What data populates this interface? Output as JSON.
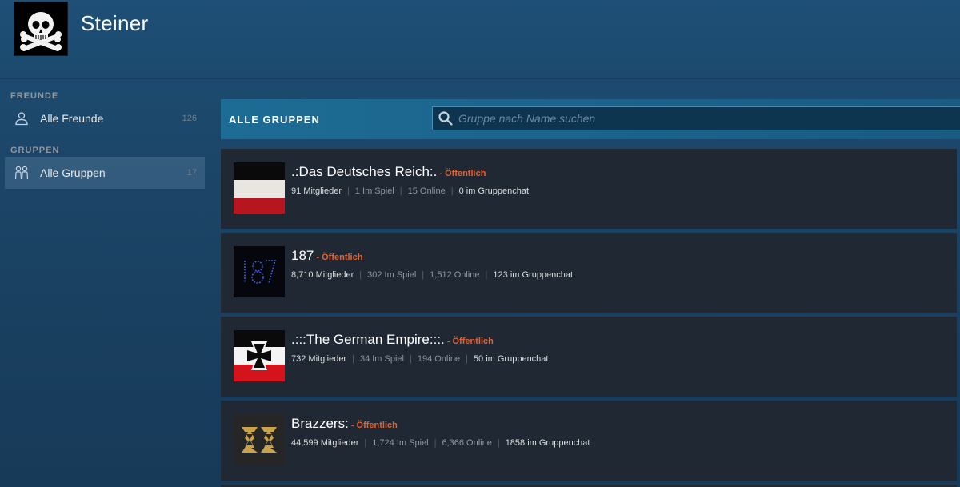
{
  "profile": {
    "name": "Steiner",
    "avatar_icon": "skull-avatar-icon"
  },
  "sidebar": {
    "friends_heading": "FREUNDE",
    "groups_heading": "GRUPPEN",
    "items": [
      {
        "label": "Alle Freunde",
        "count": "126",
        "icon": "person-icon"
      },
      {
        "label": "Alle Gruppen",
        "count": "17",
        "icon": "group-icon",
        "active": true
      }
    ]
  },
  "main": {
    "title": "ALLE GRUPPEN",
    "search": {
      "placeholder": "Gruppe nach Name suchen",
      "value": ""
    }
  },
  "groups": [
    {
      "name": ".:Das Deutsches Reich:.",
      "visibility": "- Öffentlich",
      "members": "91 Mitglieder",
      "in_game": "1 Im Spiel",
      "online": "15 Online",
      "in_chat": "0 im Gruppenchat",
      "avatar_icon": "black-white-red-flag-icon"
    },
    {
      "name": "187",
      "visibility": "- Öffentlich",
      "members": "8,710 Mitglieder",
      "in_game": "302 Im Spiel",
      "online": "1,512 Online",
      "in_chat": "123 im Gruppenchat",
      "avatar_icon": "187-logo-icon"
    },
    {
      "name": ".:::The German Empire:::.",
      "visibility": "- Öffentlich",
      "members": "732 Mitglieder",
      "in_game": "34 Im Spiel",
      "online": "194 Online",
      "in_chat": "50 im Gruppenchat",
      "avatar_icon": "iron-cross-flag-icon"
    },
    {
      "name": "Brazzers:",
      "visibility": "- Öffentlich",
      "members": "44,599 Mitglieder",
      "in_game": "1,724 Im Spiel",
      "online": "6,366 Online",
      "in_chat": "1858 im Gruppenchat",
      "avatar_icon": "zz-logo-icon"
    }
  ],
  "colors": {
    "accent_public": "#e3612f",
    "card_bg": "#1f2833",
    "groups_bar": "#1d6c95"
  }
}
